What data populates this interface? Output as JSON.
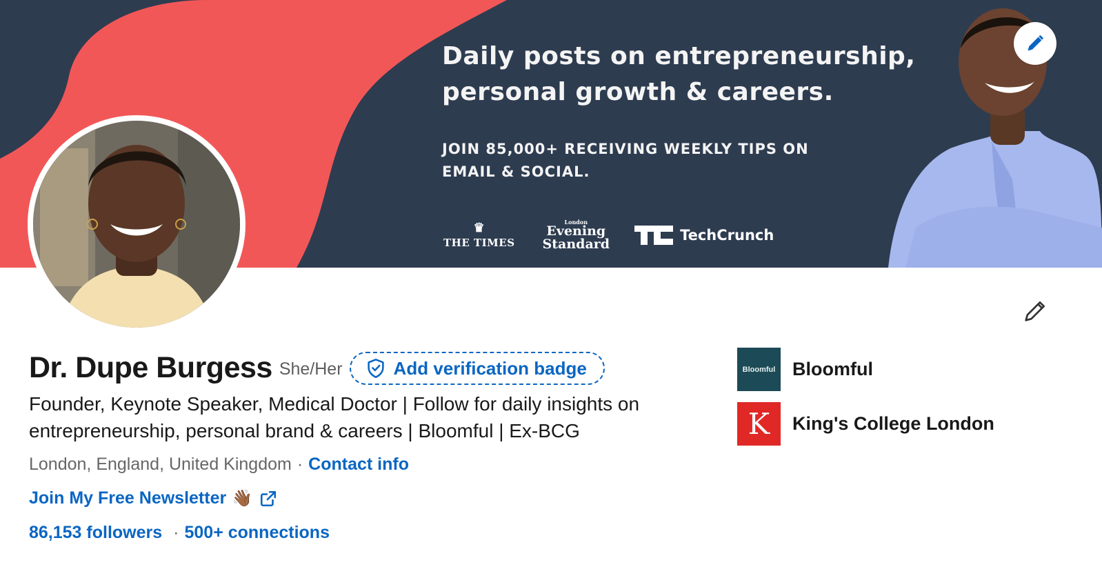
{
  "banner": {
    "headline_line1": "Daily posts on entrepreneurship,",
    "headline_line2": "personal growth & careers.",
    "sub_line1": "JOIN 85,000+ RECEIVING WEEKLY TIPS ON",
    "sub_line2": "EMAIL & SOCIAL.",
    "press": {
      "times": "THE TIMES",
      "evening_standard_small": "London",
      "evening_standard_top": "Evening",
      "evening_standard_bottom": "Standard",
      "techcrunch": "TechCrunch"
    },
    "colors": {
      "navy": "#2e3c50",
      "coral": "#f25757"
    }
  },
  "profile": {
    "name": "Dr. Dupe Burgess",
    "pronouns": "She/Her",
    "verification_label": "Add verification badge",
    "headline": "Founder, Keynote Speaker, Medical Doctor | Follow for daily insights on entrepreneurship, personal brand & careers | Bloomful | Ex-BCG",
    "location": "London, England, United Kingdom",
    "separator": "·",
    "contact_info": "Contact info",
    "newsletter_label": "Join My Free Newsletter",
    "newsletter_emoji": "👋🏾",
    "followers": "86,153 followers",
    "connections": "500+ connections"
  },
  "organizations": [
    {
      "logo_text": "Bloomful",
      "name": "Bloomful"
    },
    {
      "logo_text": "K",
      "name": "King's College London"
    }
  ],
  "icons": {
    "banner_edit": "pencil-icon",
    "intro_edit": "pencil-icon",
    "verify": "shield-check-icon",
    "external": "external-link-icon"
  },
  "accent_color": "#0a66c2"
}
